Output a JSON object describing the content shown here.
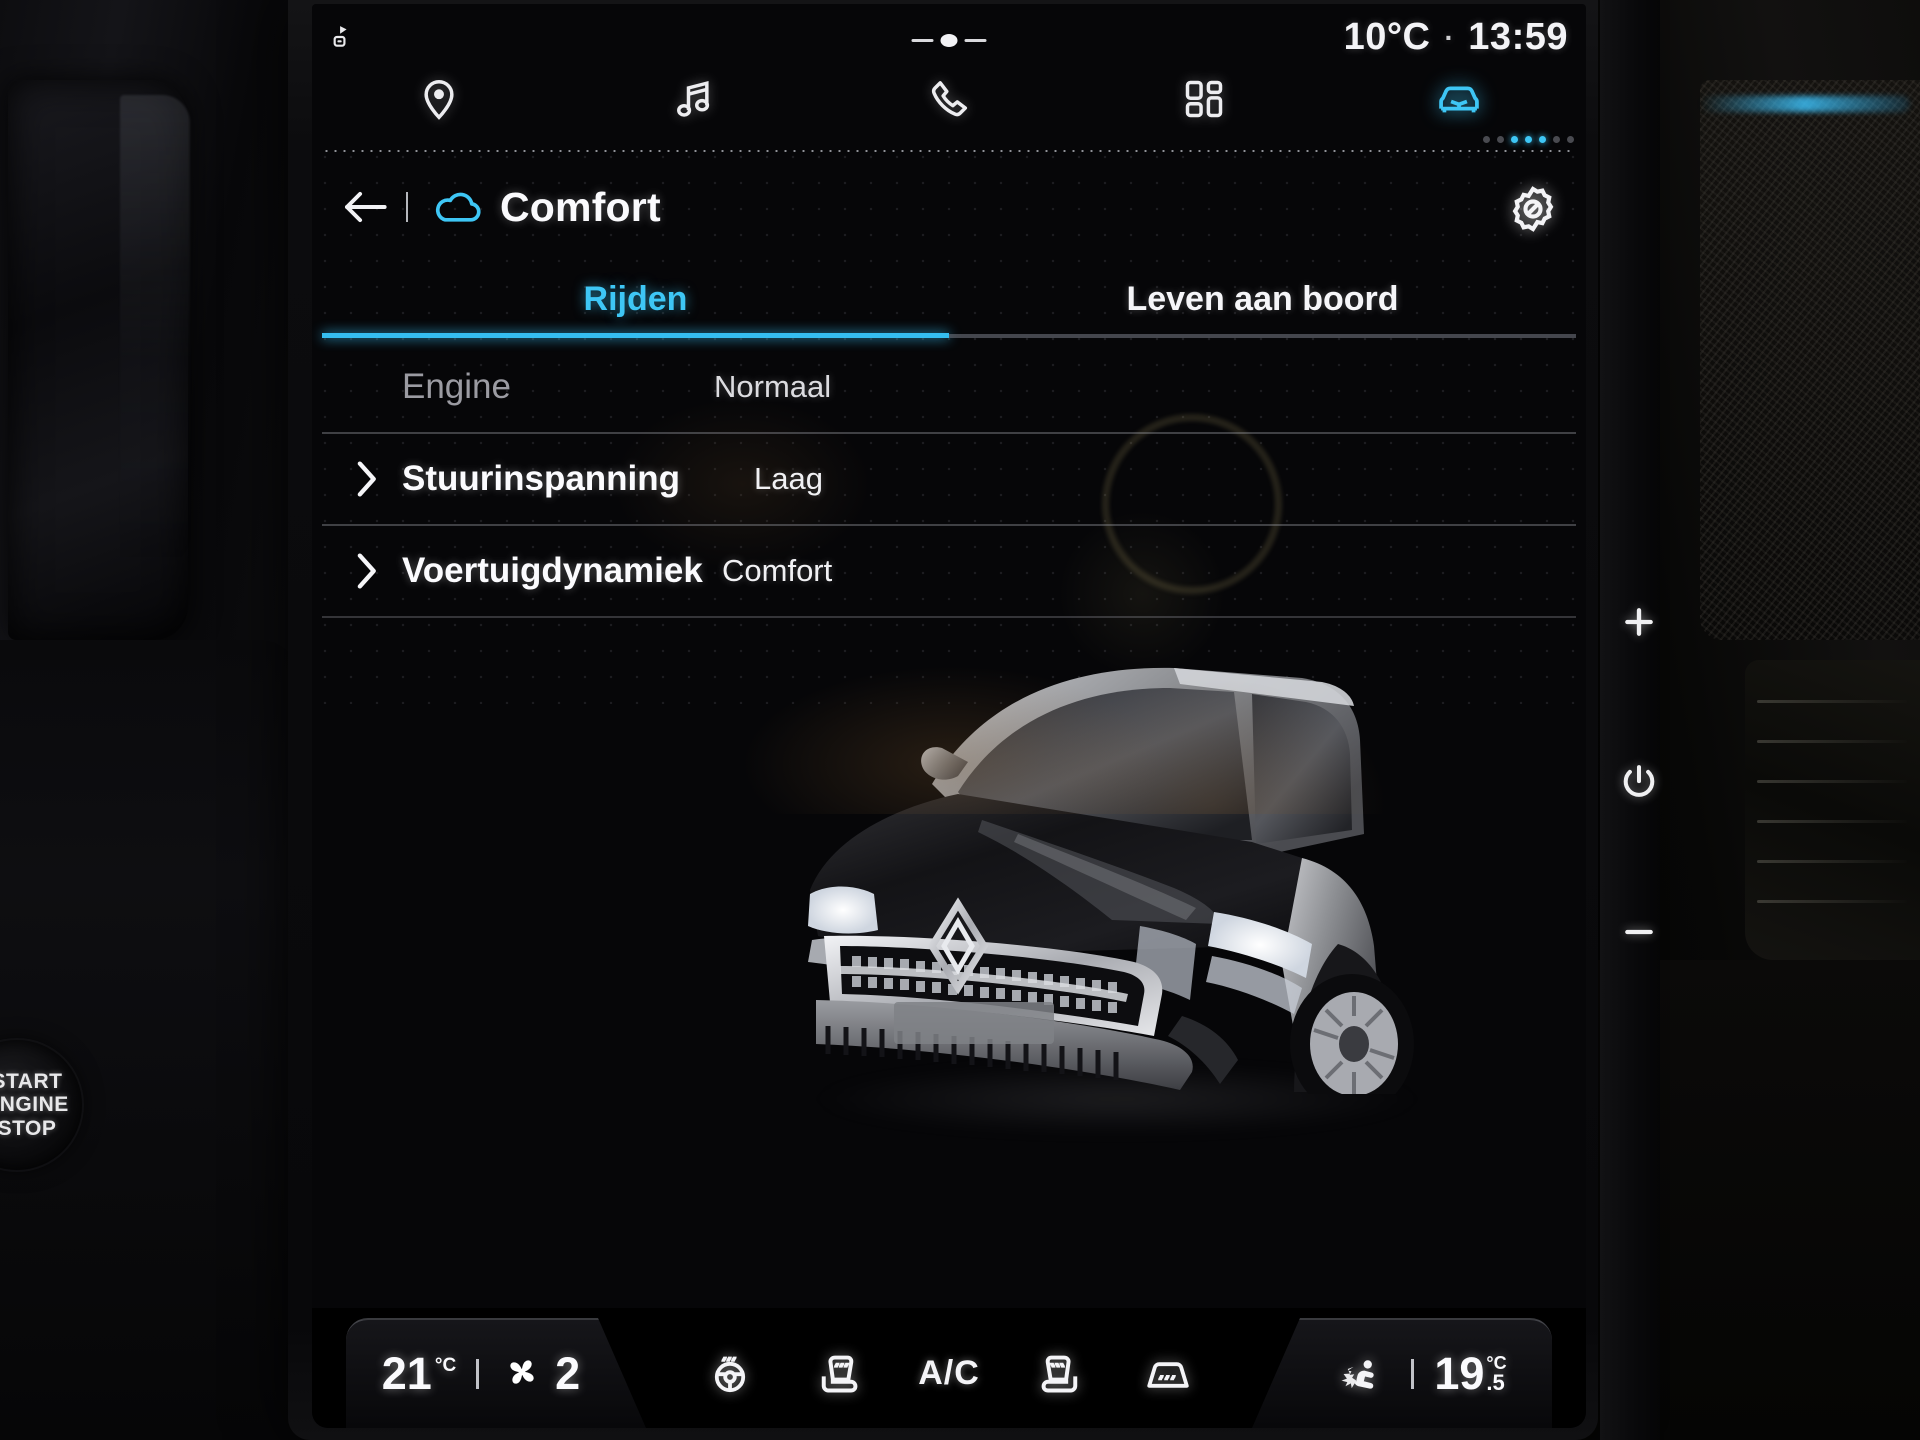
{
  "status_bar": {
    "nav_icon": "navigation-status-icon",
    "temperature": "10°C",
    "separator": "·",
    "time": "13:59"
  },
  "main_nav": {
    "items": [
      {
        "name": "navigation",
        "icon": "location-pin-icon",
        "active": false
      },
      {
        "name": "media",
        "icon": "music-note-icon",
        "active": false
      },
      {
        "name": "phone",
        "icon": "phone-handset-icon",
        "active": false
      },
      {
        "name": "apps",
        "icon": "apps-grid-icon",
        "active": false
      },
      {
        "name": "vehicle",
        "icon": "car-front-icon",
        "active": true
      }
    ],
    "page_dots": {
      "total": 3,
      "active_index": 2,
      "accent": "#3ec6f5"
    }
  },
  "header": {
    "back_icon": "back-arrow-icon",
    "mode_icon": "cloud-icon",
    "title": "Comfort",
    "settings_icon": "gear-icon"
  },
  "tabs": [
    {
      "label": "Rijden",
      "active": true
    },
    {
      "label": "Leven aan boord",
      "active": false
    }
  ],
  "settings_rows": [
    {
      "label": "Engine",
      "value": "Normaal",
      "chevron": false,
      "disabled": true
    },
    {
      "label": "Stuurinspanning",
      "value": "Laag",
      "chevron": true,
      "disabled": false
    },
    {
      "label": "Voertuigdynamiek",
      "value": "Comfort",
      "chevron": true,
      "disabled": false
    }
  ],
  "hero": {
    "alt": "Renault SUV front three-quarter view",
    "brand_logo": "renault-diamond-logo"
  },
  "climate_bar": {
    "left": {
      "temperature": "21",
      "unit": "°C",
      "divider": "|",
      "fan_icon": "fan-blades-icon",
      "fan_speed": "2"
    },
    "icons": [
      {
        "name": "heated-steering-wheel",
        "label": ""
      },
      {
        "name": "heated-seat-left",
        "label": ""
      },
      {
        "name": "ac-toggle",
        "label": "A/C"
      },
      {
        "name": "heated-seat-right",
        "label": ""
      },
      {
        "name": "rear-defrost",
        "label": ""
      }
    ],
    "right": {
      "airflow_icon": "airflow-person-icon",
      "divider": "|",
      "temperature": "19",
      "decimal": ".5",
      "unit": "°C"
    }
  },
  "hardware_buttons": [
    {
      "name": "volume-up",
      "glyph": "+"
    },
    {
      "name": "power",
      "glyph": "power"
    },
    {
      "name": "volume-down",
      "glyph": "−"
    }
  ],
  "cabin": {
    "start_engine_stop": "START\nENGINE\nSTOP"
  },
  "colors": {
    "accent": "#3ec6f5",
    "screen_bg": "#060608",
    "text": "#fafafd",
    "muted": "#9b9ba2"
  }
}
